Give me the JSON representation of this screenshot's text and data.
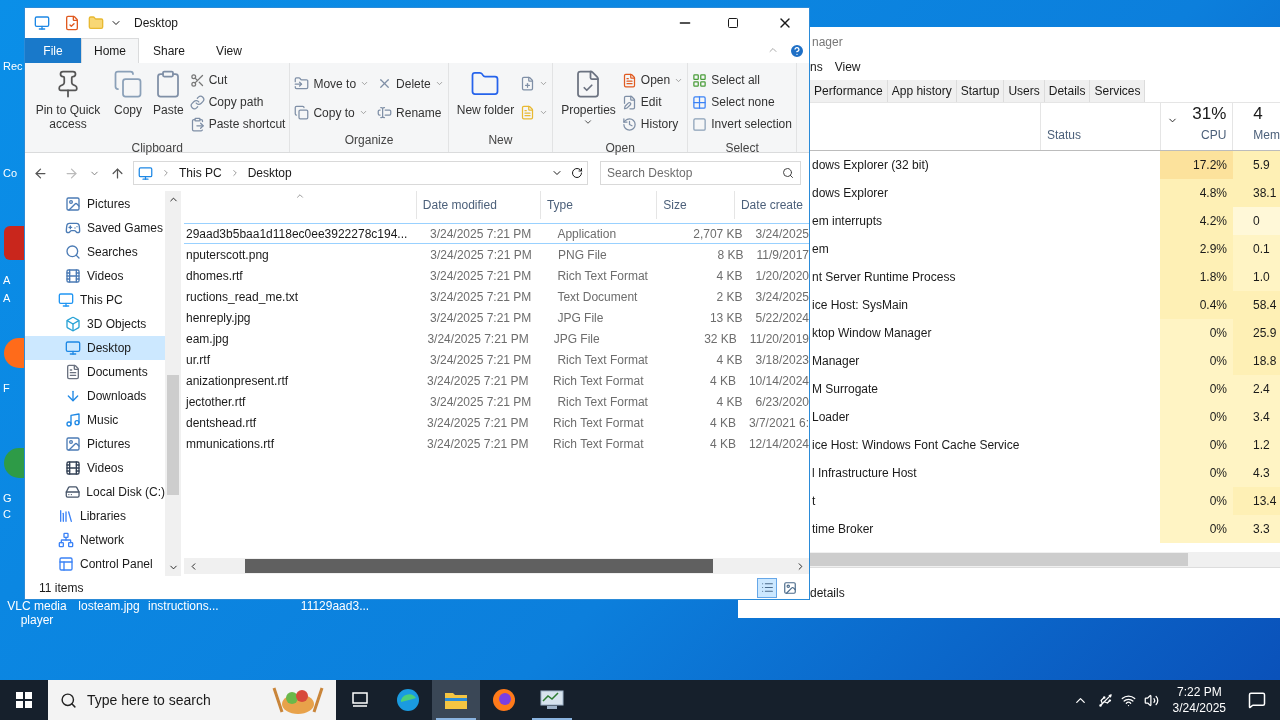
{
  "desktop": {
    "edge_labels": [
      "Rec",
      "Co",
      "A",
      "A",
      "F",
      "G",
      "C"
    ],
    "icons": [
      {
        "label": "VLC media player"
      },
      {
        "label": "losteam.jpg"
      },
      {
        "label": "instructions..."
      },
      {
        "label": "11129aad3..."
      }
    ]
  },
  "task_manager": {
    "title": "nager",
    "menu": [
      "ns",
      "View"
    ],
    "tabs": [
      {
        "label": "Performance",
        "selected": false
      },
      {
        "label": "App history",
        "selected": false
      },
      {
        "label": "Startup",
        "selected": false
      },
      {
        "label": "Users",
        "selected": false
      },
      {
        "label": "Details",
        "selected": false
      },
      {
        "label": "Services",
        "selected": false
      }
    ],
    "columns": {
      "status": "Status",
      "cpu_total": "31%",
      "cpu": "CPU",
      "mem_total": "4",
      "mem": "Mem"
    },
    "rows": [
      {
        "name": "dows Explorer (32 bit)",
        "cpu": {
          "text": "17.2%",
          "color": "#fce29c"
        },
        "mem": {
          "text": "5.9",
          "color": "#fef0b5"
        }
      },
      {
        "name": "dows Explorer",
        "cpu": {
          "text": "4.8%",
          "color": "#fef0b5"
        },
        "mem": {
          "text": "38.1",
          "color": "#fef0b5"
        }
      },
      {
        "name": "em interrupts",
        "cpu": {
          "text": "4.2%",
          "color": "#fef0b5"
        },
        "mem": {
          "text": "0",
          "color": "#fff8d8"
        }
      },
      {
        "name": "em",
        "cpu": {
          "text": "2.9%",
          "color": "#fef0b5"
        },
        "mem": {
          "text": "0.1",
          "color": "#fff4c4"
        }
      },
      {
        "name": "nt Server Runtime Process",
        "cpu": {
          "text": "1.8%",
          "color": "#fef0b5"
        },
        "mem": {
          "text": "1.0",
          "color": "#fff4c4"
        }
      },
      {
        "name": "ice Host: SysMain",
        "cpu": {
          "text": "0.4%",
          "color": "#fef0b5"
        },
        "mem": {
          "text": "58.4",
          "color": "#fef0b5"
        }
      },
      {
        "name": "ktop Window Manager",
        "cpu": {
          "text": "0%",
          "color": "#fff4c4"
        },
        "mem": {
          "text": "25.9",
          "color": "#fef0b5"
        }
      },
      {
        "name": "Manager",
        "cpu": {
          "text": "0%",
          "color": "#fff4c4"
        },
        "mem": {
          "text": "18.8",
          "color": "#fef0b5"
        }
      },
      {
        "name": "M Surrogate",
        "cpu": {
          "text": "0%",
          "color": "#fff4c4"
        },
        "mem": {
          "text": "2.4",
          "color": "#fff4c4"
        }
      },
      {
        "name": "Loader",
        "cpu": {
          "text": "0%",
          "color": "#fff4c4"
        },
        "mem": {
          "text": "3.4",
          "color": "#fff4c4"
        }
      },
      {
        "name": "ice Host: Windows Font Cache Service",
        "cpu": {
          "text": "0%",
          "color": "#fff4c4"
        },
        "mem": {
          "text": "1.2",
          "color": "#fff4c4"
        }
      },
      {
        "name": "l Infrastructure Host",
        "cpu": {
          "text": "0%",
          "color": "#fff4c4"
        },
        "mem": {
          "text": "4.3",
          "color": "#fff4c4"
        }
      },
      {
        "name": "t",
        "cpu": {
          "text": "0%",
          "color": "#fff4c4"
        },
        "mem": {
          "text": "13.4",
          "color": "#fef0b5"
        }
      },
      {
        "name": "time Broker",
        "cpu": {
          "text": "0%",
          "color": "#fff4c4"
        },
        "mem": {
          "text": "3.3",
          "color": "#fff4c4"
        }
      }
    ],
    "details_link": "details"
  },
  "explorer": {
    "title": "Desktop",
    "ribbon_tabs": [
      {
        "label": "File",
        "kind": "file",
        "selected": false
      },
      {
        "label": "Home",
        "kind": "tab",
        "selected": true
      },
      {
        "label": "Share",
        "kind": "tab",
        "selected": false
      },
      {
        "label": "View",
        "kind": "tab",
        "selected": false
      }
    ],
    "ribbon_groups": [
      {
        "label": "Clipboard",
        "buttons": [
          {
            "label": "Pin to Quick access",
            "kind": "large"
          },
          {
            "label": "Copy",
            "kind": "large"
          },
          {
            "label": "Paste",
            "kind": "large"
          },
          {
            "label": "Cut",
            "kind": "small"
          },
          {
            "label": "Copy path",
            "kind": "small"
          },
          {
            "label": "Paste shortcut",
            "kind": "small"
          }
        ]
      },
      {
        "label": "Organize",
        "buttons": [
          {
            "label": "Move to",
            "kind": "small",
            "dropdown": true
          },
          {
            "label": "Copy to",
            "kind": "small",
            "dropdown": true
          },
          {
            "label": "Delete",
            "kind": "small",
            "dropdown": true
          },
          {
            "label": "Rename",
            "kind": "small"
          }
        ]
      },
      {
        "label": "New",
        "buttons": [
          {
            "label": "New folder",
            "kind": "large"
          },
          {
            "kind": "icon",
            "dropdown": true
          },
          {
            "kind": "icon",
            "dropdown": true
          }
        ]
      },
      {
        "label": "Open",
        "buttons": [
          {
            "label": "Properties",
            "kind": "large",
            "dropdown": true
          },
          {
            "label": "Open",
            "kind": "small",
            "dropdown": true
          },
          {
            "label": "Edit",
            "kind": "small"
          },
          {
            "label": "History",
            "kind": "small"
          }
        ]
      },
      {
        "label": "Select",
        "buttons": [
          {
            "label": "Select all",
            "kind": "small"
          },
          {
            "label": "Select none",
            "kind": "small"
          },
          {
            "label": "Invert selection",
            "kind": "small"
          }
        ]
      }
    ],
    "address": [
      "This PC",
      "Desktop"
    ],
    "search_placeholder": "Search Desktop",
    "nav_partial": [
      {
        "label": "Pictures",
        "selected": false
      },
      {
        "label": "Saved Games",
        "selected": false
      },
      {
        "label": "Searches",
        "selected": false
      },
      {
        "label": "Videos",
        "selected": false
      }
    ],
    "nav_tree": [
      {
        "label": "This PC",
        "selected": false,
        "children": [
          {
            "label": "3D Objects",
            "selected": false
          },
          {
            "label": "Desktop",
            "selected": true
          },
          {
            "label": "Documents",
            "selected": false
          },
          {
            "label": "Downloads",
            "selected": false
          },
          {
            "label": "Music",
            "selected": false
          },
          {
            "label": "Pictures",
            "selected": false
          },
          {
            "label": "Videos",
            "selected": false
          },
          {
            "label": "Local Disk (C:)",
            "selected": false
          }
        ]
      },
      {
        "label": "Libraries",
        "selected": false
      },
      {
        "label": "Network",
        "selected": false
      },
      {
        "label": "Control Panel",
        "selected": false
      }
    ],
    "columns": [
      "Date modified",
      "Type",
      "Size",
      "Date create"
    ],
    "files": [
      {
        "name": "29aad3b5baa1d118ec0ee3922278c194...",
        "modified": "3/24/2025 7:21 PM",
        "type": "Application",
        "size": "2,707 KB",
        "created": "3/24/2025",
        "focused": true
      },
      {
        "name": "nputerscott.png",
        "modified": "3/24/2025 7:21 PM",
        "type": "PNG File",
        "size": "8 KB",
        "created": "11/9/2017",
        "focused": false
      },
      {
        "name": "dhomes.rtf",
        "modified": "3/24/2025 7:21 PM",
        "type": "Rich Text Format",
        "size": "4 KB",
        "created": "1/20/2020",
        "focused": false
      },
      {
        "name": "ructions_read_me.txt",
        "modified": "3/24/2025 7:21 PM",
        "type": "Text Document",
        "size": "2 KB",
        "created": "3/24/2025",
        "focused": false
      },
      {
        "name": "henreply.jpg",
        "modified": "3/24/2025 7:21 PM",
        "type": "JPG File",
        "size": "13 KB",
        "created": "5/22/2024",
        "focused": false
      },
      {
        "name": "eam.jpg",
        "modified": "3/24/2025 7:21 PM",
        "type": "JPG File",
        "size": "32 KB",
        "created": "11/20/2019",
        "focused": false
      },
      {
        "name": "ur.rtf",
        "modified": "3/24/2025 7:21 PM",
        "type": "Rich Text Format",
        "size": "4 KB",
        "created": "3/18/2023",
        "focused": false
      },
      {
        "name": "anizationpresent.rtf",
        "modified": "3/24/2025 7:21 PM",
        "type": "Rich Text Format",
        "size": "4 KB",
        "created": "10/14/2024",
        "focused": false
      },
      {
        "name": "jectother.rtf",
        "modified": "3/24/2025 7:21 PM",
        "type": "Rich Text Format",
        "size": "4 KB",
        "created": "6/23/2020",
        "focused": false
      },
      {
        "name": "dentshead.rtf",
        "modified": "3/24/2025 7:21 PM",
        "type": "Rich Text Format",
        "size": "4 KB",
        "created": "3/7/2021 6:",
        "focused": false
      },
      {
        "name": "mmunications.rtf",
        "modified": "3/24/2025 7:21 PM",
        "type": "Rich Text Format",
        "size": "4 KB",
        "created": "12/14/2024",
        "focused": false
      }
    ],
    "status": "11 items"
  },
  "taskbar": {
    "search_placeholder": "Type here to search",
    "apps": [
      {
        "kind": "task_view",
        "selected": false,
        "running": false
      },
      {
        "kind": "edge",
        "selected": false,
        "running": false
      },
      {
        "kind": "explorer",
        "selected": true,
        "running": true
      },
      {
        "kind": "firefox",
        "selected": false,
        "running": false
      },
      {
        "kind": "task_manager",
        "selected": false,
        "running": true
      }
    ],
    "time": "7:22 PM",
    "date": "3/24/2025"
  }
}
